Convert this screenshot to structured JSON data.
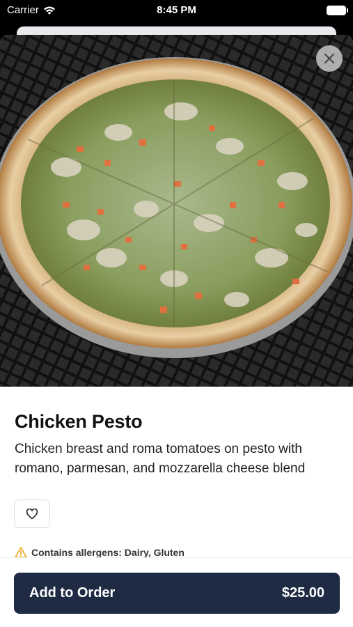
{
  "status_bar": {
    "carrier": "Carrier",
    "time": "8:45 PM"
  },
  "item": {
    "name": "Chicken Pesto",
    "description": "Chicken breast and roma tomatoes on pesto with romano, parmesan, and mozzarella cheese blend",
    "allergens": "Contains allergens: Dairy, Gluten"
  },
  "order_button": {
    "label": "Add to Order",
    "price": "$25.00"
  },
  "icons": {
    "close": "close-icon",
    "favorite": "heart-icon",
    "warning": "warning-triangle-icon",
    "wifi": "wifi-icon",
    "battery": "battery-icon"
  },
  "colors": {
    "order_button_bg": "#1e2b43",
    "warning": "#e8a317"
  }
}
